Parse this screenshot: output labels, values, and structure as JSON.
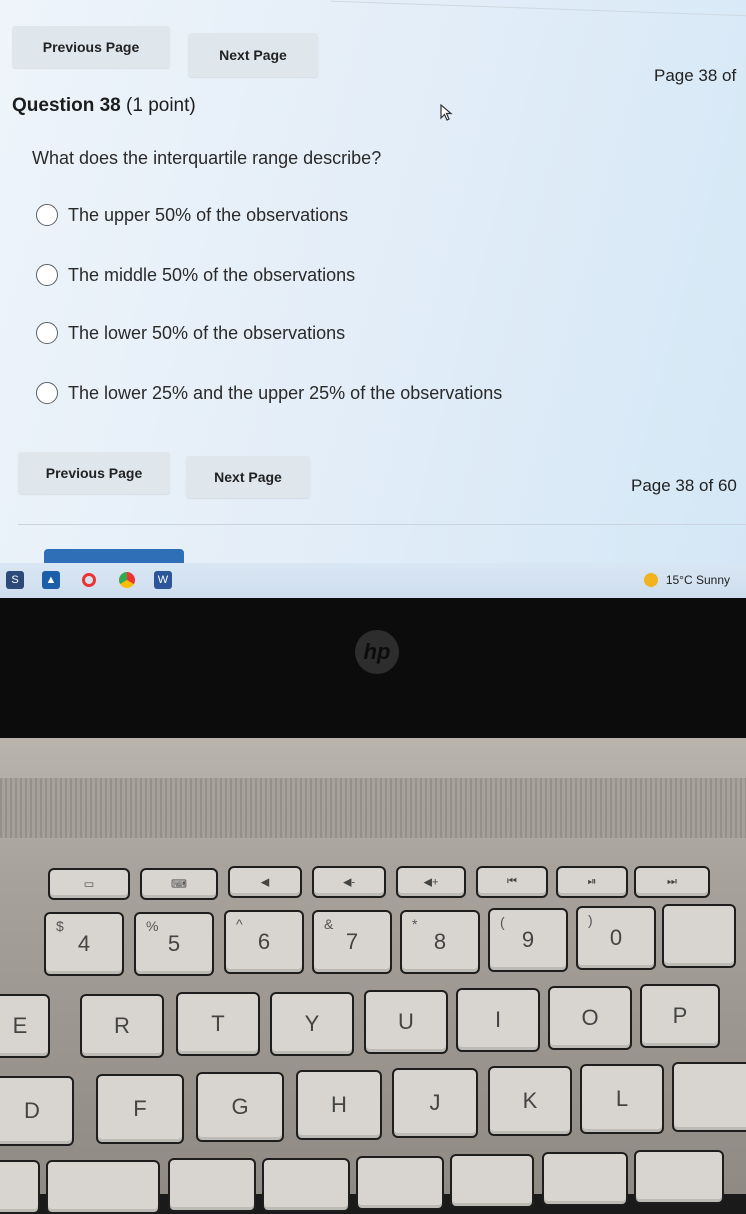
{
  "screen": {
    "top_nav": {
      "previous_label": "Previous Page",
      "next_label": "Next Page",
      "page_indicator": "Page 38 of"
    },
    "question": {
      "number": "Question 38",
      "points": "(1 point)",
      "text": "What does the interquartile range describe?",
      "options": [
        "The upper 50% of the observations",
        "The middle 50% of the observations",
        "The lower 50% of the observations",
        "The lower 25% and the upper 25% of the observations"
      ]
    },
    "bottom_nav": {
      "previous_label": "Previous Page",
      "next_label": "Next Page",
      "page_indicator": "Page 38 of 60"
    },
    "taskbar": {
      "weather": "15°C Sunny"
    }
  },
  "laptop": {
    "logo": "hp",
    "fkeys": [
      "",
      "",
      "",
      "",
      "",
      "",
      "",
      ""
    ],
    "number_row": [
      {
        "main": "4",
        "sub": "$"
      },
      {
        "main": "5",
        "sub": "%"
      },
      {
        "main": "6",
        "sub": "^"
      },
      {
        "main": "7",
        "sub": "&"
      },
      {
        "main": "8",
        "sub": "*"
      },
      {
        "main": "9",
        "sub": "("
      },
      {
        "main": "0",
        "sub": ")"
      }
    ],
    "letter_row_1": [
      "E",
      "R",
      "T",
      "Y",
      "U",
      "I",
      "O",
      "P"
    ],
    "letter_row_2": [
      "D",
      "F",
      "G",
      "H",
      "J",
      "K",
      "L"
    ]
  },
  "colors": {
    "screen_bg": "#e4eef8",
    "button_bg": "#dfe6ec",
    "taskbar_tab": "#2f6fb8"
  }
}
